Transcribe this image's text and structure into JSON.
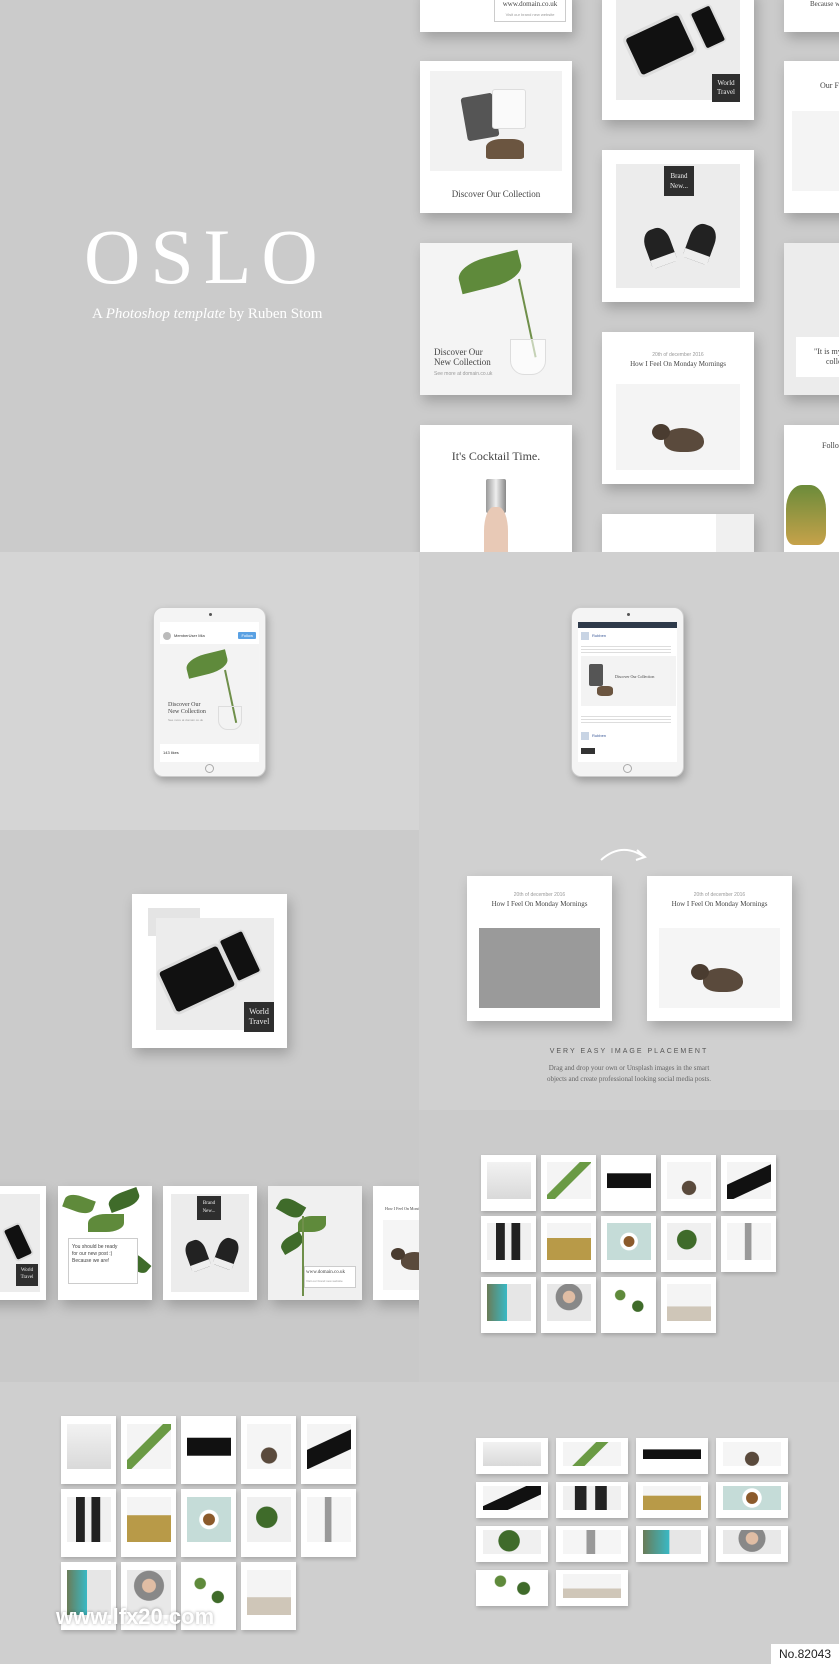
{
  "hero": {
    "title": "OSLO",
    "subtitle_pre": "A ",
    "subtitle_em": "Photoshop template",
    "subtitle_post": " by Ruben Stom"
  },
  "cards": {
    "domain_text": "www.domain.co.uk",
    "domain_sub": "Visit our brand new website",
    "world_travel_1": "World",
    "world_travel_2": "Travel",
    "discover_collection": "Discover Our Collection",
    "brand_new_1": "Brand",
    "brand_new_2": "New...",
    "discover_new_1": "Discover Our",
    "discover_new_2": "New Collection",
    "see_more": "See more at domain.co.uk",
    "date": "20th of december 2016",
    "monday": "How I Feel On Monday Mornings",
    "cocktail": "It's Cocktail Time.",
    "because": "Because we",
    "our": "Our F",
    "it_is_my": "\"It is my",
    "collec": "collec",
    "follow": "Follo",
    "ready_1": "You should be ready",
    "ready_2": "for our new post :)",
    "ready_3": "Because we are!",
    "follow_instagram": "Follow Our Instagram",
    "good_morning": "Good Morning Everybody"
  },
  "ipad1": {
    "handle": "MemberUser Mia",
    "follow_button": "Follow",
    "discover_1": "Discover Our",
    "discover_2": "New Collection",
    "see_more": "See more at domain.co.uk",
    "likes": "143 likes"
  },
  "ipad2": {
    "header": "Rubben",
    "card_title": "Discover Our Collection",
    "footer_user": "Rubben"
  },
  "placement": {
    "heading": "VERY EASY IMAGE PLACEMENT",
    "body_1": "Drag and drop your own or Unsplash images in the smart",
    "body_2": "objects and create professional looking social media posts."
  },
  "watermark": {
    "site": "www.lfx20.com",
    "number": "No.82043"
  }
}
